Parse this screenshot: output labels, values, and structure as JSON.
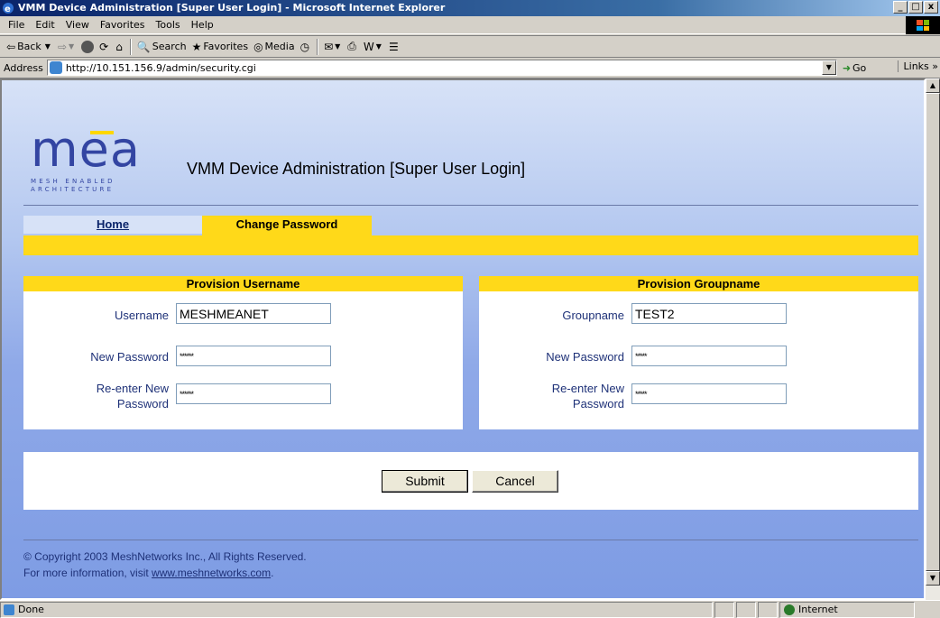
{
  "window": {
    "title": "VMM Device Administration [Super User Login] - Microsoft Internet Explorer",
    "min": "_",
    "max": "□",
    "close": "x"
  },
  "menu": [
    "File",
    "Edit",
    "View",
    "Favorites",
    "Tools",
    "Help"
  ],
  "toolbar": {
    "back": "Back",
    "search": "Search",
    "favorites": "Favorites",
    "media": "Media"
  },
  "address": {
    "label": "Address",
    "url": "http://10.151.156.9/admin/security.cgi",
    "go": "Go",
    "links": "Links »"
  },
  "page": {
    "logo_text": "mea",
    "logo_sub_1": "MESH ENABLED",
    "logo_sub_2": "ARCHITECTURE",
    "title": "VMM Device Administration [Super User Login]",
    "tabs": {
      "home": "Home",
      "change_password": "Change Password"
    }
  },
  "username_panel": {
    "heading": "Provision Username",
    "username_label": "Username",
    "username_value": "MESHMEANET",
    "new_password_label": "New Password",
    "new_password_value": "******",
    "reenter_label_1": "Re-enter New",
    "reenter_label_2": "Password",
    "reenter_value": "******"
  },
  "groupname_panel": {
    "heading": "Provision Groupname",
    "groupname_label": "Groupname",
    "groupname_value": "TEST2",
    "new_password_label": "New Password",
    "new_password_value": "*****",
    "reenter_label_1": "Re-enter New",
    "reenter_label_2": "Password",
    "reenter_value": "*****"
  },
  "buttons": {
    "submit": "Submit",
    "cancel": "Cancel"
  },
  "footer": {
    "copyright": "© Copyright 2003 MeshNetworks Inc., All Rights Reserved.",
    "more_info": "For more information, visit ",
    "link": "www.meshnetworks.com",
    "period": "."
  },
  "status": {
    "text": "Done",
    "zone": "Internet"
  }
}
